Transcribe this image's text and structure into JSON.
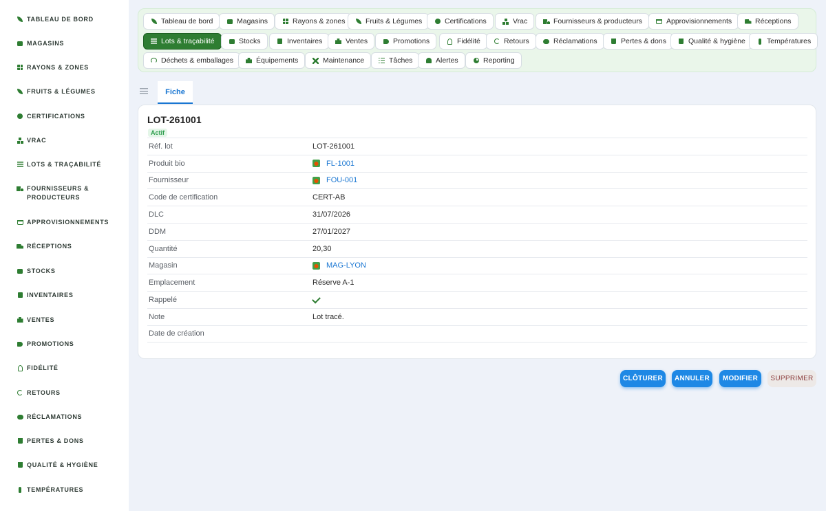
{
  "sidebar": {
    "items": [
      {
        "label": "Tableau de bord",
        "icon": "seedling-icon"
      },
      {
        "label": "Magasins",
        "icon": "store-icon"
      },
      {
        "label": "Rayons & zones",
        "icon": "grid-icon"
      },
      {
        "label": "Fruits & légumes",
        "icon": "leaf-icon"
      },
      {
        "label": "Certifications",
        "icon": "certificate-icon"
      },
      {
        "label": "Vrac",
        "icon": "boxes-icon"
      },
      {
        "label": "Lots & traçabilité",
        "icon": "barcode-icon"
      },
      {
        "label": "Fournisseurs & producteurs",
        "icon": "tractor-icon"
      },
      {
        "label": "Approvisionnements",
        "icon": "cart-icon"
      },
      {
        "label": "Réceptions",
        "icon": "truck-icon"
      },
      {
        "label": "Stocks",
        "icon": "warehouse-icon"
      },
      {
        "label": "Inventaires",
        "icon": "clipboard-check-icon"
      },
      {
        "label": "Ventes",
        "icon": "cash-register-icon"
      },
      {
        "label": "Promotions",
        "icon": "tag-icon"
      },
      {
        "label": "Fidélité",
        "icon": "award-icon"
      },
      {
        "label": "Retours",
        "icon": "undo-icon"
      },
      {
        "label": "Réclamations",
        "icon": "comment-icon"
      },
      {
        "label": "Pertes & dons",
        "icon": "trash-icon"
      },
      {
        "label": "Qualité & hygiène",
        "icon": "trash-icon"
      },
      {
        "label": "Températures",
        "icon": "thermometer-icon"
      }
    ]
  },
  "chips": [
    {
      "label": "Tableau de bord",
      "icon": "seedling-icon"
    },
    {
      "label": "Magasins",
      "icon": "store-icon"
    },
    {
      "label": "Rayons & zones",
      "icon": "grid-icon"
    },
    {
      "label": "Fruits & Légumes",
      "icon": "leaf-icon"
    },
    {
      "label": "Certifications",
      "icon": "certificate-icon"
    },
    {
      "label": "Vrac",
      "icon": "boxes-icon"
    },
    {
      "label": "Fournisseurs & producteurs",
      "icon": "tractor-icon"
    },
    {
      "label": "Approvisionnements",
      "icon": "cart-icon"
    },
    {
      "label": "Réceptions",
      "icon": "truck-icon"
    },
    {
      "label": "Lots & traçabilité",
      "icon": "barcode-icon",
      "active": true
    },
    {
      "label": "Stocks",
      "icon": "warehouse-icon"
    },
    {
      "label": "Inventaires",
      "icon": "clipboard-check-icon"
    },
    {
      "label": "Ventes",
      "icon": "cash-register-icon"
    },
    {
      "label": "Promotions",
      "icon": "tag-icon"
    },
    {
      "label": "Fidélité",
      "icon": "award-icon"
    },
    {
      "label": "Retours",
      "icon": "undo-icon"
    },
    {
      "label": "Réclamations",
      "icon": "comment-icon"
    },
    {
      "label": "Pertes & dons",
      "icon": "trash-icon"
    },
    {
      "label": "Qualité & hygiène",
      "icon": "trash-icon"
    },
    {
      "label": "Températures",
      "icon": "thermometer-icon"
    },
    {
      "label": "Déchets & emballages",
      "icon": "recycle-icon"
    },
    {
      "label": "Équipements",
      "icon": "equipment-icon"
    },
    {
      "label": "Maintenance",
      "icon": "tools-icon"
    },
    {
      "label": "Tâches",
      "icon": "tasks-icon"
    },
    {
      "label": "Alertes",
      "icon": "bell-icon"
    },
    {
      "label": "Reporting",
      "icon": "chart-pie-icon"
    }
  ],
  "tabs": {
    "list_icon": "list-icon",
    "fiche_label": "Fiche"
  },
  "record": {
    "title": "LOT-261001",
    "status": "Actif",
    "fields": [
      {
        "label": "Réf. lot",
        "value": "LOT-261001",
        "type": "text"
      },
      {
        "label": "Produit bio",
        "value": "FL-1001",
        "type": "link"
      },
      {
        "label": "Fournisseur",
        "value": "FOU-001",
        "type": "link"
      },
      {
        "label": "Code de certification",
        "value": "CERT-AB",
        "type": "text"
      },
      {
        "label": "DLC",
        "value": "31/07/2026",
        "type": "text"
      },
      {
        "label": "DDM",
        "value": "27/01/2027",
        "type": "text"
      },
      {
        "label": "Quantité",
        "value": "20,30",
        "type": "text"
      },
      {
        "label": "Magasin",
        "value": "MAG-LYON",
        "type": "link"
      },
      {
        "label": "Emplacement",
        "value": "Réserve A-1",
        "type": "text"
      },
      {
        "label": "Rappelé",
        "value": "",
        "type": "check"
      },
      {
        "label": "Note",
        "value": "Lot tracé.",
        "type": "text"
      },
      {
        "label": "Date de création",
        "value": "",
        "type": "text"
      }
    ]
  },
  "actions": {
    "close_label": "CLÔTURER",
    "cancel_label": "ANNULER",
    "edit_label": "MODIFIER",
    "delete_label": "SUPPRIMER"
  },
  "colors": {
    "accent_green": "#2e7d32",
    "link_blue": "#1976d2",
    "primary_button": "#1e88e5",
    "status_green": "#2e9d4e"
  }
}
